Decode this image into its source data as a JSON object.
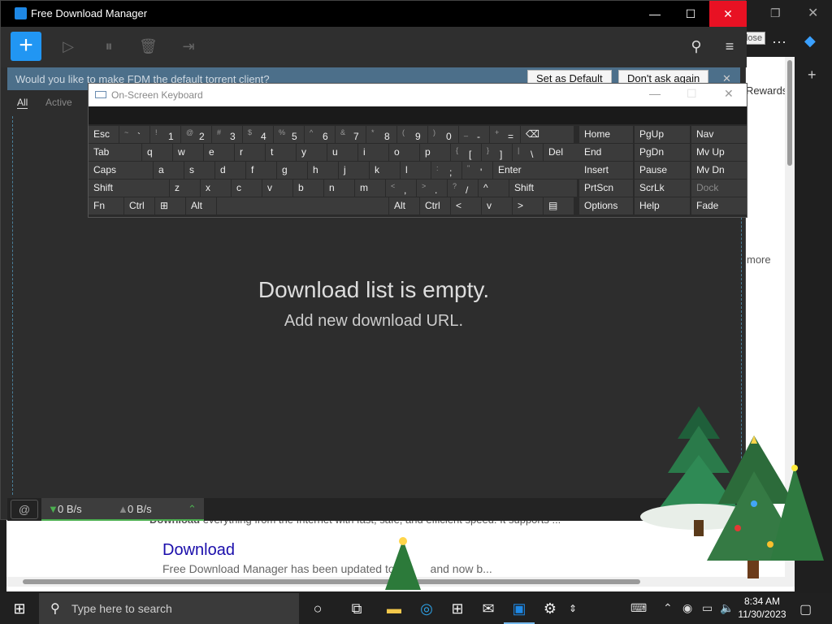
{
  "browser": {
    "rewards_text": "Rewards",
    "more_text": "more",
    "download_desc_prefix": "Download",
    "download_desc_top": "everything from the Internet with fast, safe, and efficient speed. It supports ...",
    "download_title": "Download",
    "download_desc": "Free Download Manager has been updated to",
    "download_desc_tail": "and now b..."
  },
  "fdm": {
    "window_title": "Free Download Manager",
    "close_tooltip": "Close",
    "notice_text": "Would you like to make FDM the default torrent client?",
    "set_default_label": "Set as Default",
    "dont_ask_label": "Don't ask again",
    "tabs": [
      {
        "label": "All"
      },
      {
        "label": "Active"
      }
    ],
    "empty_title": "Download list is empty.",
    "empty_subtitle": "Add new download URL.",
    "download_speed": "0 B/s",
    "upload_speed": "0 B/s"
  },
  "osk": {
    "title": "On-Screen Keyboard",
    "rows": [
      [
        "Esc",
        "~ `",
        "! 1",
        "@ 2",
        "# 3",
        "$ 4",
        "% 5",
        "^ 6",
        "& 7",
        "* 8",
        "( 9",
        ") 0",
        "_ -",
        "+ =",
        "⌫"
      ],
      [
        "Tab",
        "q",
        "w",
        "e",
        "r",
        "t",
        "y",
        "u",
        "i",
        "o",
        "p",
        "{ [",
        "} ]",
        "| \\",
        "Del"
      ],
      [
        "Caps",
        "a",
        "s",
        "d",
        "f",
        "g",
        "h",
        "j",
        "k",
        "l",
        ": ;",
        "\" '",
        "Enter"
      ],
      [
        "Shift",
        "z",
        "x",
        "c",
        "v",
        "b",
        "n",
        "m",
        "< ,",
        "> .",
        "? /",
        "^",
        "Shift"
      ],
      [
        "Fn",
        "Ctrl",
        "⊞",
        "Alt",
        "",
        "Alt",
        "Ctrl",
        "<",
        "v",
        ">",
        "▤"
      ]
    ],
    "nav_keys": [
      [
        "Home",
        "PgUp",
        "Nav"
      ],
      [
        "End",
        "PgDn",
        "Mv Up"
      ],
      [
        "Insert",
        "Pause",
        "Mv Dn"
      ],
      [
        "PrtScn",
        "ScrLk",
        "Dock"
      ],
      [
        "Options",
        "Help",
        "Fade"
      ]
    ]
  },
  "taskbar": {
    "search_placeholder": "Type here to search",
    "time": "8:34 AM",
    "date": "11/30/2023"
  }
}
